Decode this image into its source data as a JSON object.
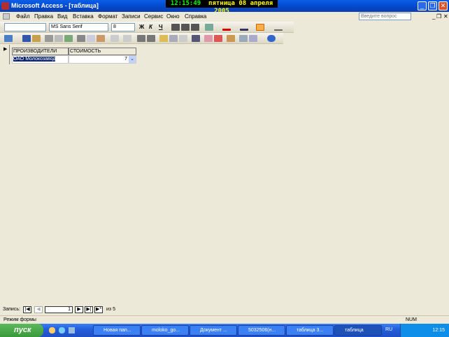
{
  "window": {
    "title": "Microsoft Access - [таблица]",
    "clock_time": "12:15:49",
    "clock_date": "пятница 08 апреля 2005"
  },
  "menu": [
    "Файл",
    "Правка",
    "Вид",
    "Вставка",
    "Формат",
    "Записи",
    "Сервис",
    "Окно",
    "Справка"
  ],
  "ask_placeholder": "Введите вопрос",
  "format_toolbar": {
    "object": "",
    "font": "MS Sans Serif",
    "size": "8",
    "bold": "Ж",
    "italic": "К",
    "underline": "Ч"
  },
  "table": {
    "headers": [
      "ПРОИЗВОДИТЕЛИ",
      "СТОИМОСТЬ"
    ],
    "row": [
      "ОАО Молокозавод",
      "7"
    ]
  },
  "nav": {
    "label": "Запись:",
    "current": "1",
    "of": "из 5"
  },
  "status": {
    "mode": "Режим формы",
    "num": "NUM"
  },
  "taskbar": {
    "start": "пуск",
    "tasks": [
      "Новая пап...",
      "moloko_go...",
      "Документ ...",
      "5032506(н...",
      "таблица 3...",
      "таблица"
    ],
    "lang": "RU",
    "time": "12:15"
  }
}
